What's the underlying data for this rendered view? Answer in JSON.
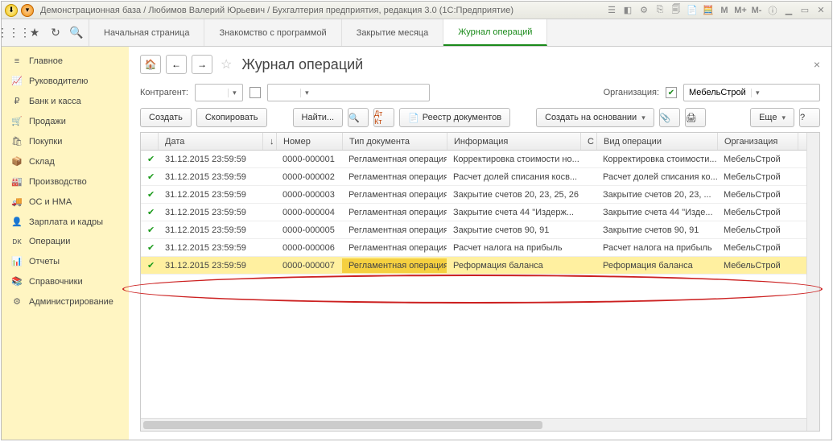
{
  "titlebar": {
    "text": "Демонстрационная база / Любимов Валерий Юрьевич / Бухгалтерия предприятия, редакция 3.0  (1С:Предприятие)"
  },
  "tabs": [
    {
      "label": "Начальная страница",
      "active": false
    },
    {
      "label": "Знакомство с программой",
      "active": false
    },
    {
      "label": "Закрытие месяца",
      "active": false
    },
    {
      "label": "Журнал операций",
      "active": true
    }
  ],
  "sidebar": [
    {
      "icon": "≡",
      "label": "Главное"
    },
    {
      "icon": "📈",
      "label": "Руководителю"
    },
    {
      "icon": "₽",
      "label": "Банк и касса"
    },
    {
      "icon": "🛒",
      "label": "Продажи"
    },
    {
      "icon": "🛍",
      "label": "Покупки"
    },
    {
      "icon": "📦",
      "label": "Склад"
    },
    {
      "icon": "🏭",
      "label": "Производство"
    },
    {
      "icon": "🚚",
      "label": "ОС и НМА"
    },
    {
      "icon": "👤",
      "label": "Зарплата и кадры"
    },
    {
      "icon": "ᴅᴋ",
      "label": "Операции"
    },
    {
      "icon": "📊",
      "label": "Отчеты"
    },
    {
      "icon": "📚",
      "label": "Справочники"
    },
    {
      "icon": "⚙",
      "label": "Администрирование"
    }
  ],
  "page": {
    "title": "Журнал операций",
    "filters": {
      "contragent_label": "Контрагент:",
      "org_label": "Организация:",
      "org_value": "МебельСтрой"
    },
    "toolbar": {
      "create": "Создать",
      "copy": "Скопировать",
      "find": "Найти...",
      "registry": "Реестр документов",
      "create_on": "Создать на основании",
      "more": "Еще"
    },
    "columns": {
      "date": "Дата",
      "number": "Номер",
      "doctype": "Тип документа",
      "info": "Информация",
      "c": "С",
      "optype": "Вид операции",
      "org": "Организация"
    },
    "rows": [
      {
        "date": "31.12.2015 23:59:59",
        "num": "0000-000001",
        "type": "Регламентная операция",
        "info": "Корректировка стоимости но...",
        "op": "Корректировка стоимости...",
        "org": "МебельСтрой",
        "sel": false
      },
      {
        "date": "31.12.2015 23:59:59",
        "num": "0000-000002",
        "type": "Регламентная операция",
        "info": "Расчет долей списания косв...",
        "op": "Расчет долей списания ко...",
        "org": "МебельСтрой",
        "sel": false
      },
      {
        "date": "31.12.2015 23:59:59",
        "num": "0000-000003",
        "type": "Регламентная операция",
        "info": "Закрытие счетов 20, 23, 25, 26",
        "op": "Закрытие счетов 20, 23, ...",
        "org": "МебельСтрой",
        "sel": false
      },
      {
        "date": "31.12.2015 23:59:59",
        "num": "0000-000004",
        "type": "Регламентная операция",
        "info": "Закрытие счета 44 \"Издерж...",
        "op": "Закрытие счета 44 \"Изде...",
        "org": "МебельСтрой",
        "sel": false
      },
      {
        "date": "31.12.2015 23:59:59",
        "num": "0000-000005",
        "type": "Регламентная операция",
        "info": "Закрытие счетов 90, 91",
        "op": "Закрытие счетов 90, 91",
        "org": "МебельСтрой",
        "sel": false
      },
      {
        "date": "31.12.2015 23:59:59",
        "num": "0000-000006",
        "type": "Регламентная операция",
        "info": "Расчет налога на прибыль",
        "op": "Расчет налога на прибыль",
        "org": "МебельСтрой",
        "sel": false
      },
      {
        "date": "31.12.2015 23:59:59",
        "num": "0000-000007",
        "type": "Регламентная операция",
        "info": "Реформация баланса",
        "op": "Реформация баланса",
        "org": "МебельСтрой",
        "sel": true
      }
    ]
  }
}
